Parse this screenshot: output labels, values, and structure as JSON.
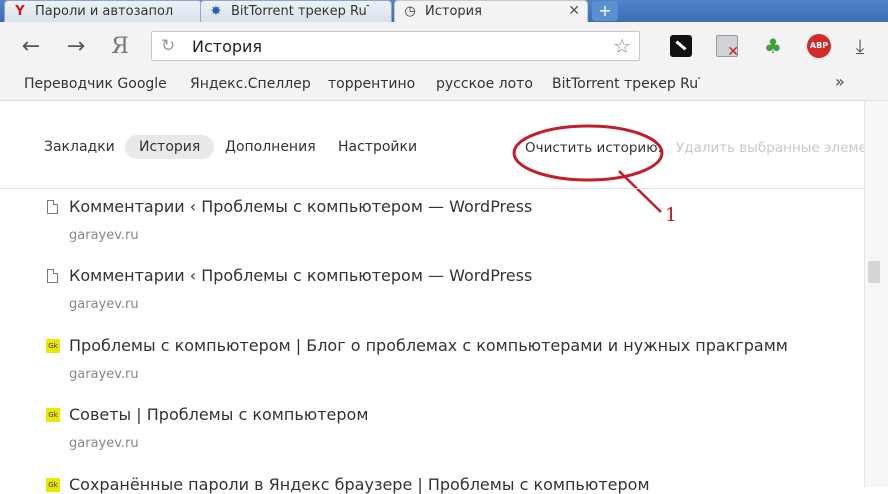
{
  "tabs": [
    {
      "title": "Пароли и автозапол",
      "favicon": "yandex-icon",
      "active": false
    },
    {
      "title": "BitTorrent трекер RuT",
      "favicon": "bittorrent-icon",
      "active": false
    },
    {
      "title": "История",
      "favicon": "clock-icon",
      "active": true
    }
  ],
  "new_tab_label": "+",
  "address": {
    "value": "История"
  },
  "browser_logo": "Я",
  "bookmarks": [
    "Переводчик Google",
    "Яндекс.Спеллер",
    "торрентино",
    "русское лото",
    "BitTorrent трекер RuT"
  ],
  "bookmarks_more": "»",
  "subnav": {
    "items": [
      "Закладки",
      "История",
      "Дополнения",
      "Настройки"
    ],
    "active": "История"
  },
  "actions": {
    "clear": "Очистить историю.",
    "delete": "Удалить выбранные элемен"
  },
  "annotation": {
    "number": "1",
    "color": "#c01e2a"
  },
  "history": [
    {
      "title": "Комментарии ‹ Проблемы с компьютером — WordPress",
      "domain": "garayev.ru",
      "icon": "page-icon"
    },
    {
      "title": "Комментарии ‹ Проблемы с компьютером — WordPress",
      "domain": "garayev.ru",
      "icon": "page-icon"
    },
    {
      "title": "Проблемы с компьютером | Блог о проблемах с компьютерами и нужных пракграмм",
      "domain": "garayev.ru",
      "icon": "site-icon"
    },
    {
      "title": "Советы | Проблемы с компьютером",
      "domain": "garayev.ru",
      "icon": "site-icon"
    },
    {
      "title": "Сохранённые пароли в Яндекс браузере | Проблемы с компьютером",
      "domain": "",
      "icon": "site-icon"
    }
  ],
  "site_icon_text": "Gk"
}
